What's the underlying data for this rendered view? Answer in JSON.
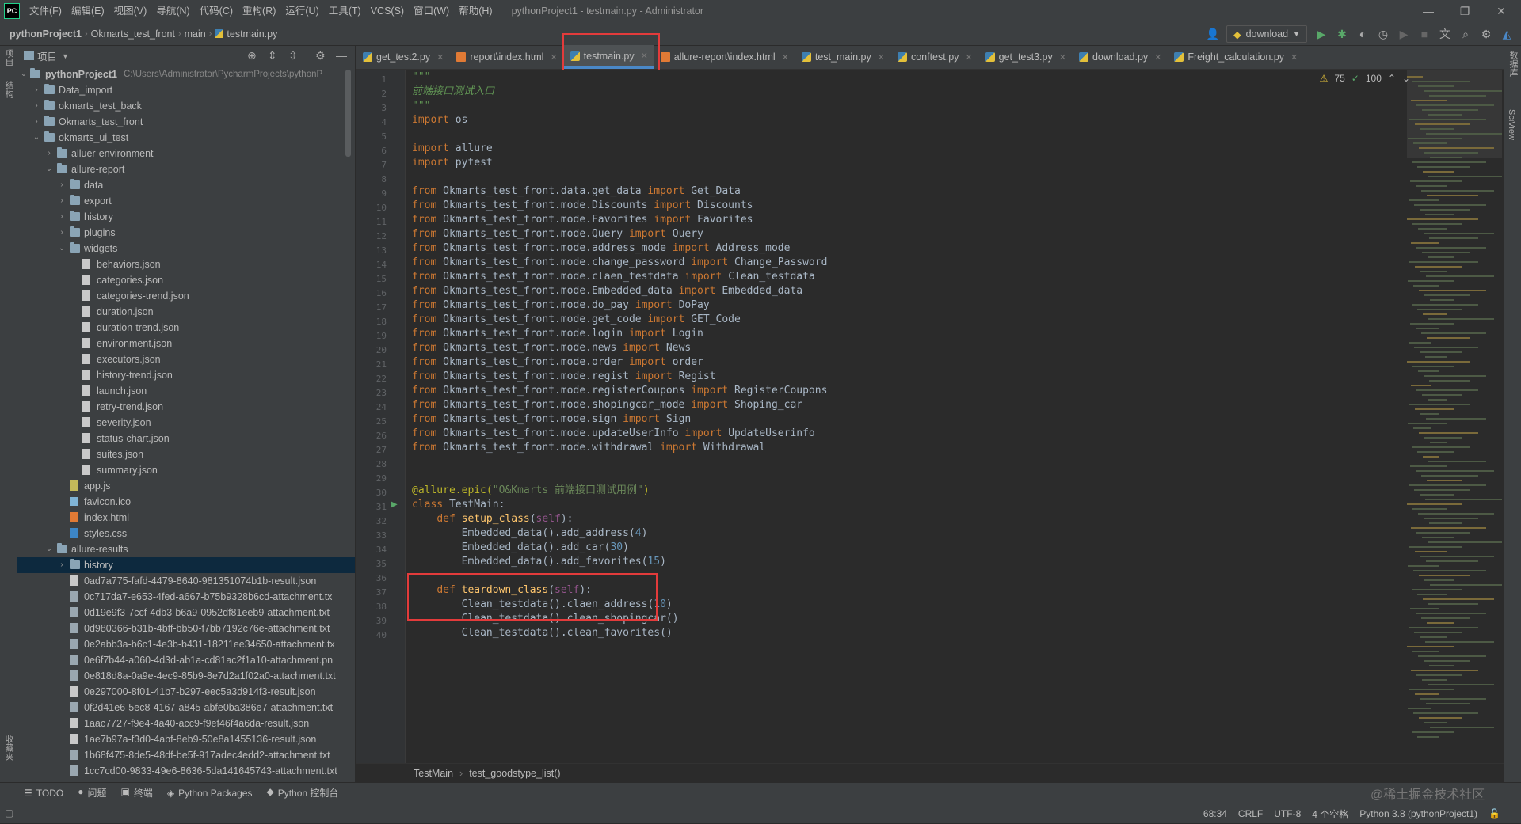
{
  "app": {
    "logo_text": "PC",
    "menu": [
      "文件(F)",
      "编辑(E)",
      "视图(V)",
      "导航(N)",
      "代码(C)",
      "重构(R)",
      "运行(U)",
      "工具(T)",
      "VCS(S)",
      "窗口(W)",
      "帮助(H)"
    ],
    "window_title": "pythonProject1 - testmain.py - Administrator"
  },
  "navbar": {
    "crumbs": [
      "pythonProject1",
      "Okmarts_test_front",
      "main",
      "testmain.py"
    ],
    "run_config": "download"
  },
  "left_strip": {
    "tabs": [
      "项目",
      "结构",
      "收藏夹"
    ]
  },
  "right_strip": {
    "tabs": [
      "数据库",
      "SciView"
    ]
  },
  "project_panel": {
    "title": "项目",
    "root_name": "pythonProject1",
    "root_path": "C:\\Users\\Administrator\\PycharmProjects\\pythonP",
    "items": [
      {
        "label": "Data_import",
        "depth": 1,
        "type": "folder",
        "open": false
      },
      {
        "label": "okmarts_test_back",
        "depth": 1,
        "type": "folder",
        "open": false
      },
      {
        "label": "Okmarts_test_front",
        "depth": 1,
        "type": "folder",
        "open": false
      },
      {
        "label": "okmarts_ui_test",
        "depth": 1,
        "type": "folder",
        "open": true
      },
      {
        "label": "alluer-environment",
        "depth": 2,
        "type": "folder",
        "open": false
      },
      {
        "label": "allure-report",
        "depth": 2,
        "type": "folder",
        "open": true
      },
      {
        "label": "data",
        "depth": 3,
        "type": "folder",
        "open": false
      },
      {
        "label": "export",
        "depth": 3,
        "type": "folder",
        "open": false
      },
      {
        "label": "history",
        "depth": 3,
        "type": "folder",
        "open": false
      },
      {
        "label": "plugins",
        "depth": 3,
        "type": "folder",
        "open": false
      },
      {
        "label": "widgets",
        "depth": 3,
        "type": "folder",
        "open": true
      },
      {
        "label": "behaviors.json",
        "depth": 4,
        "type": "json"
      },
      {
        "label": "categories.json",
        "depth": 4,
        "type": "json"
      },
      {
        "label": "categories-trend.json",
        "depth": 4,
        "type": "json"
      },
      {
        "label": "duration.json",
        "depth": 4,
        "type": "json"
      },
      {
        "label": "duration-trend.json",
        "depth": 4,
        "type": "json"
      },
      {
        "label": "environment.json",
        "depth": 4,
        "type": "json"
      },
      {
        "label": "executors.json",
        "depth": 4,
        "type": "json"
      },
      {
        "label": "history-trend.json",
        "depth": 4,
        "type": "json"
      },
      {
        "label": "launch.json",
        "depth": 4,
        "type": "json"
      },
      {
        "label": "retry-trend.json",
        "depth": 4,
        "type": "json"
      },
      {
        "label": "severity.json",
        "depth": 4,
        "type": "json"
      },
      {
        "label": "status-chart.json",
        "depth": 4,
        "type": "json"
      },
      {
        "label": "suites.json",
        "depth": 4,
        "type": "json"
      },
      {
        "label": "summary.json",
        "depth": 4,
        "type": "json"
      },
      {
        "label": "app.js",
        "depth": 3,
        "type": "js"
      },
      {
        "label": "favicon.ico",
        "depth": 3,
        "type": "ico"
      },
      {
        "label": "index.html",
        "depth": 3,
        "type": "html"
      },
      {
        "label": "styles.css",
        "depth": 3,
        "type": "css"
      },
      {
        "label": "allure-results",
        "depth": 2,
        "type": "folder",
        "open": true
      },
      {
        "label": "history",
        "depth": 3,
        "type": "folder",
        "open": false,
        "selected": true
      },
      {
        "label": "0ad7a775-fafd-4479-8640-981351074b1b-result.json",
        "depth": 3,
        "type": "json"
      },
      {
        "label": "0c717da7-e653-4fed-a667-b75b9328b6cd-attachment.tx",
        "depth": 3,
        "type": "file"
      },
      {
        "label": "0d19e9f3-7ccf-4db3-b6a9-0952df81eeb9-attachment.txt",
        "depth": 3,
        "type": "file"
      },
      {
        "label": "0d980366-b31b-4bff-bb50-f7bb7192c76e-attachment.txt",
        "depth": 3,
        "type": "file"
      },
      {
        "label": "0e2abb3a-b6c1-4e3b-b431-18211ee34650-attachment.tx",
        "depth": 3,
        "type": "file"
      },
      {
        "label": "0e6f7b44-a060-4d3d-ab1a-cd81ac2f1a10-attachment.pn",
        "depth": 3,
        "type": "file"
      },
      {
        "label": "0e818d8a-0a9e-4ec9-85b9-8e7d2a1f02a0-attachment.txt",
        "depth": 3,
        "type": "file"
      },
      {
        "label": "0e297000-8f01-41b7-b297-eec5a3d914f3-result.json",
        "depth": 3,
        "type": "json"
      },
      {
        "label": "0f2d41e6-5ec8-4167-a845-abfe0ba386e7-attachment.txt",
        "depth": 3,
        "type": "file"
      },
      {
        "label": "1aac7727-f9e4-4a40-acc9-f9ef46f4a6da-result.json",
        "depth": 3,
        "type": "json"
      },
      {
        "label": "1ae7b97a-f3d0-4abf-8eb9-50e8a1455136-result.json",
        "depth": 3,
        "type": "json"
      },
      {
        "label": "1b68f475-8de5-48df-be5f-917adec4edd2-attachment.txt",
        "depth": 3,
        "type": "file"
      },
      {
        "label": "1cc7cd00-9833-49e6-8636-5da141645743-attachment.txt",
        "depth": 3,
        "type": "file"
      }
    ]
  },
  "tabs": [
    {
      "label": "get_test2.py",
      "kind": "py"
    },
    {
      "label": "report\\index.html",
      "kind": "html"
    },
    {
      "label": "testmain.py",
      "kind": "py",
      "active": true
    },
    {
      "label": "allure-report\\index.html",
      "kind": "html"
    },
    {
      "label": "test_main.py",
      "kind": "py"
    },
    {
      "label": "conftest.py",
      "kind": "py"
    },
    {
      "label": "get_test3.py",
      "kind": "py"
    },
    {
      "label": "download.py",
      "kind": "py"
    },
    {
      "label": "Freight_calculation.py",
      "kind": "py"
    }
  ],
  "inspection": {
    "warnings": "75",
    "checks": "100"
  },
  "code_lines": [
    [
      [
        "doc",
        "\"\"\""
      ]
    ],
    [
      [
        "doc",
        "前端接口测试入口"
      ]
    ],
    [
      [
        "doc",
        "\"\"\""
      ]
    ],
    [
      [
        "kw",
        "import "
      ],
      [
        "p",
        "os"
      ]
    ],
    [],
    [
      [
        "kw",
        "import "
      ],
      [
        "p",
        "allure"
      ]
    ],
    [
      [
        "kw",
        "import "
      ],
      [
        "p",
        "pytest"
      ]
    ],
    [],
    [
      [
        "kw",
        "from "
      ],
      [
        "p",
        "Okmarts_test_front.data.get_data "
      ],
      [
        "kw",
        "import "
      ],
      [
        "p",
        "Get_Data"
      ]
    ],
    [
      [
        "kw",
        "from "
      ],
      [
        "p",
        "Okmarts_test_front.mode.Discounts "
      ],
      [
        "kw",
        "import "
      ],
      [
        "p",
        "Discounts"
      ]
    ],
    [
      [
        "kw",
        "from "
      ],
      [
        "p",
        "Okmarts_test_front.mode.Favorites "
      ],
      [
        "kw",
        "import "
      ],
      [
        "p",
        "Favorites"
      ]
    ],
    [
      [
        "kw",
        "from "
      ],
      [
        "p",
        "Okmarts_test_front.mode.Query "
      ],
      [
        "kw",
        "import "
      ],
      [
        "p",
        "Query"
      ]
    ],
    [
      [
        "kw",
        "from "
      ],
      [
        "p",
        "Okmarts_test_front.mode.address_mode "
      ],
      [
        "kw",
        "import "
      ],
      [
        "p",
        "Address_mode"
      ]
    ],
    [
      [
        "kw",
        "from "
      ],
      [
        "p",
        "Okmarts_test_front.mode.change_password "
      ],
      [
        "kw",
        "import "
      ],
      [
        "p",
        "Change_Password"
      ]
    ],
    [
      [
        "kw",
        "from "
      ],
      [
        "p",
        "Okmarts_test_front.mode.claen_testdata "
      ],
      [
        "kw",
        "import "
      ],
      [
        "p",
        "Clean_testdata"
      ]
    ],
    [
      [
        "kw",
        "from "
      ],
      [
        "p",
        "Okmarts_test_front.mode.Embedded_data "
      ],
      [
        "kw",
        "import "
      ],
      [
        "p",
        "Embedded_data"
      ]
    ],
    [
      [
        "kw",
        "from "
      ],
      [
        "p",
        "Okmarts_test_front.mode.do_pay "
      ],
      [
        "kw",
        "import "
      ],
      [
        "p",
        "DoPay"
      ]
    ],
    [
      [
        "kw",
        "from "
      ],
      [
        "p",
        "Okmarts_test_front.mode.get_code "
      ],
      [
        "kw",
        "import "
      ],
      [
        "p",
        "GET_Code"
      ]
    ],
    [
      [
        "kw",
        "from "
      ],
      [
        "p",
        "Okmarts_test_front.mode.login "
      ],
      [
        "kw",
        "import "
      ],
      [
        "p",
        "Login"
      ]
    ],
    [
      [
        "kw",
        "from "
      ],
      [
        "p",
        "Okmarts_test_front.mode.news "
      ],
      [
        "kw",
        "import "
      ],
      [
        "p",
        "News"
      ]
    ],
    [
      [
        "kw",
        "from "
      ],
      [
        "p",
        "Okmarts_test_front.mode.order "
      ],
      [
        "kw",
        "import "
      ],
      [
        "p",
        "order"
      ]
    ],
    [
      [
        "kw",
        "from "
      ],
      [
        "p",
        "Okmarts_test_front.mode.regist "
      ],
      [
        "kw",
        "import "
      ],
      [
        "p",
        "Regist"
      ]
    ],
    [
      [
        "kw",
        "from "
      ],
      [
        "p",
        "Okmarts_test_front.mode.registerCoupons "
      ],
      [
        "kw",
        "import "
      ],
      [
        "p",
        "RegisterCoupons"
      ]
    ],
    [
      [
        "kw",
        "from "
      ],
      [
        "p",
        "Okmarts_test_front.mode.shopingcar_mode "
      ],
      [
        "kw",
        "import "
      ],
      [
        "p",
        "Shoping_car"
      ]
    ],
    [
      [
        "kw",
        "from "
      ],
      [
        "p",
        "Okmarts_test_front.mode.sign "
      ],
      [
        "kw",
        "import "
      ],
      [
        "p",
        "Sign"
      ]
    ],
    [
      [
        "kw",
        "from "
      ],
      [
        "p",
        "Okmarts_test_front.mode.updateUserInfo "
      ],
      [
        "kw",
        "import "
      ],
      [
        "p",
        "UpdateUserinfo"
      ]
    ],
    [
      [
        "kw",
        "from "
      ],
      [
        "p",
        "Okmarts_test_front.mode.withdrawal "
      ],
      [
        "kw",
        "import "
      ],
      [
        "p",
        "Withdrawal"
      ]
    ],
    [],
    [],
    [
      [
        "dec",
        "@allure.epic("
      ],
      [
        "str",
        "\"O&Kmarts 前端接口测试用例\""
      ],
      [
        "dec",
        ")"
      ]
    ],
    [
      [
        "kw",
        "class "
      ],
      [
        "p",
        "TestMain:"
      ]
    ],
    [
      [
        "p",
        "    "
      ],
      [
        "kw",
        "def "
      ],
      [
        "fn",
        "setup_class"
      ],
      [
        "p",
        "("
      ],
      [
        "slf",
        "self"
      ],
      [
        "p",
        "):"
      ]
    ],
    [
      [
        "p",
        "        Embedded_data().add_address("
      ],
      [
        "num",
        "4"
      ],
      [
        "p",
        ")"
      ]
    ],
    [
      [
        "p",
        "        Embedded_data().add_car("
      ],
      [
        "num",
        "30"
      ],
      [
        "p",
        ")"
      ]
    ],
    [
      [
        "p",
        "        Embedded_data().add_favorites("
      ],
      [
        "num",
        "15"
      ],
      [
        "p",
        ")"
      ]
    ],
    [],
    [
      [
        "p",
        "    "
      ],
      [
        "kw",
        "def "
      ],
      [
        "fn",
        "teardown_class"
      ],
      [
        "p",
        "("
      ],
      [
        "slf",
        "self"
      ],
      [
        "p",
        "):"
      ]
    ],
    [
      [
        "p",
        "        Clean_testdata().claen_address("
      ],
      [
        "num",
        "10"
      ],
      [
        "p",
        ")"
      ]
    ],
    [
      [
        "p",
        "        Clean_testdata().clean_shopingcar()"
      ]
    ],
    [
      [
        "p",
        "        Clean_testdata().clean_favorites()"
      ]
    ]
  ],
  "editor_breadcrumb": [
    "TestMain",
    "test_goodstype_list()"
  ],
  "toolwindows": [
    {
      "icon": "☰",
      "label": "TODO"
    },
    {
      "icon": "●",
      "label": "问题"
    },
    {
      "icon": "▣",
      "label": "终端"
    },
    {
      "icon": "◈",
      "label": "Python Packages"
    },
    {
      "icon": "◆",
      "label": "Python 控制台"
    }
  ],
  "status": {
    "position": "68:34",
    "line_sep": "CRLF",
    "encoding": "UTF-8",
    "indent": "4 个空格",
    "interpreter": "Python 3.8 (pythonProject1)"
  },
  "watermark": "@稀土掘金技术社区",
  "colors": {
    "highlight_box": "#e33b3b",
    "active_tab_underline": "#4a88c7",
    "selected_row": "#0d293e"
  }
}
